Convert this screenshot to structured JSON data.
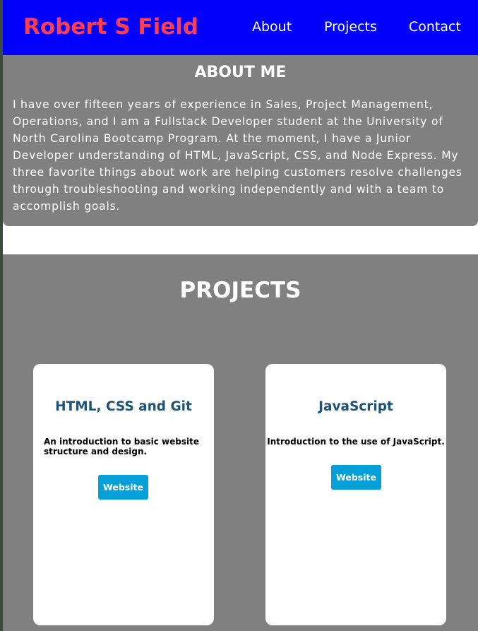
{
  "header": {
    "brand": "Robert S Field",
    "nav": {
      "about": "About",
      "projects": "Projects",
      "contact": "Contact"
    }
  },
  "about": {
    "title": "ABOUT ME",
    "text": "I have over fifteen years of experience in Sales, Project Management, Operations, and I am a Fullstack Developer student at the University of North Carolina Bootcamp Program. At the moment, I have a Junior Developer understanding of HTML, JavaScript, CSS, and Node Express. My three favorite things about work are helping customers resolve challenges through troubleshooting and working independently and with a team to accomplish goals."
  },
  "projects": {
    "title": "PROJECTS",
    "cards": [
      {
        "title": "HTML, CSS and Git",
        "description": "An introduction to basic website structure and design.",
        "button": "Website"
      },
      {
        "title": "JavaScript",
        "description": "Introduction to the use of JavaScript.",
        "button": "Website"
      }
    ]
  },
  "colors": {
    "header_bg": "#0000fb",
    "brand": "#ff3d4e",
    "section_bg": "#808080",
    "card_title": "#1f5277",
    "button_bg": "#069fd8"
  }
}
